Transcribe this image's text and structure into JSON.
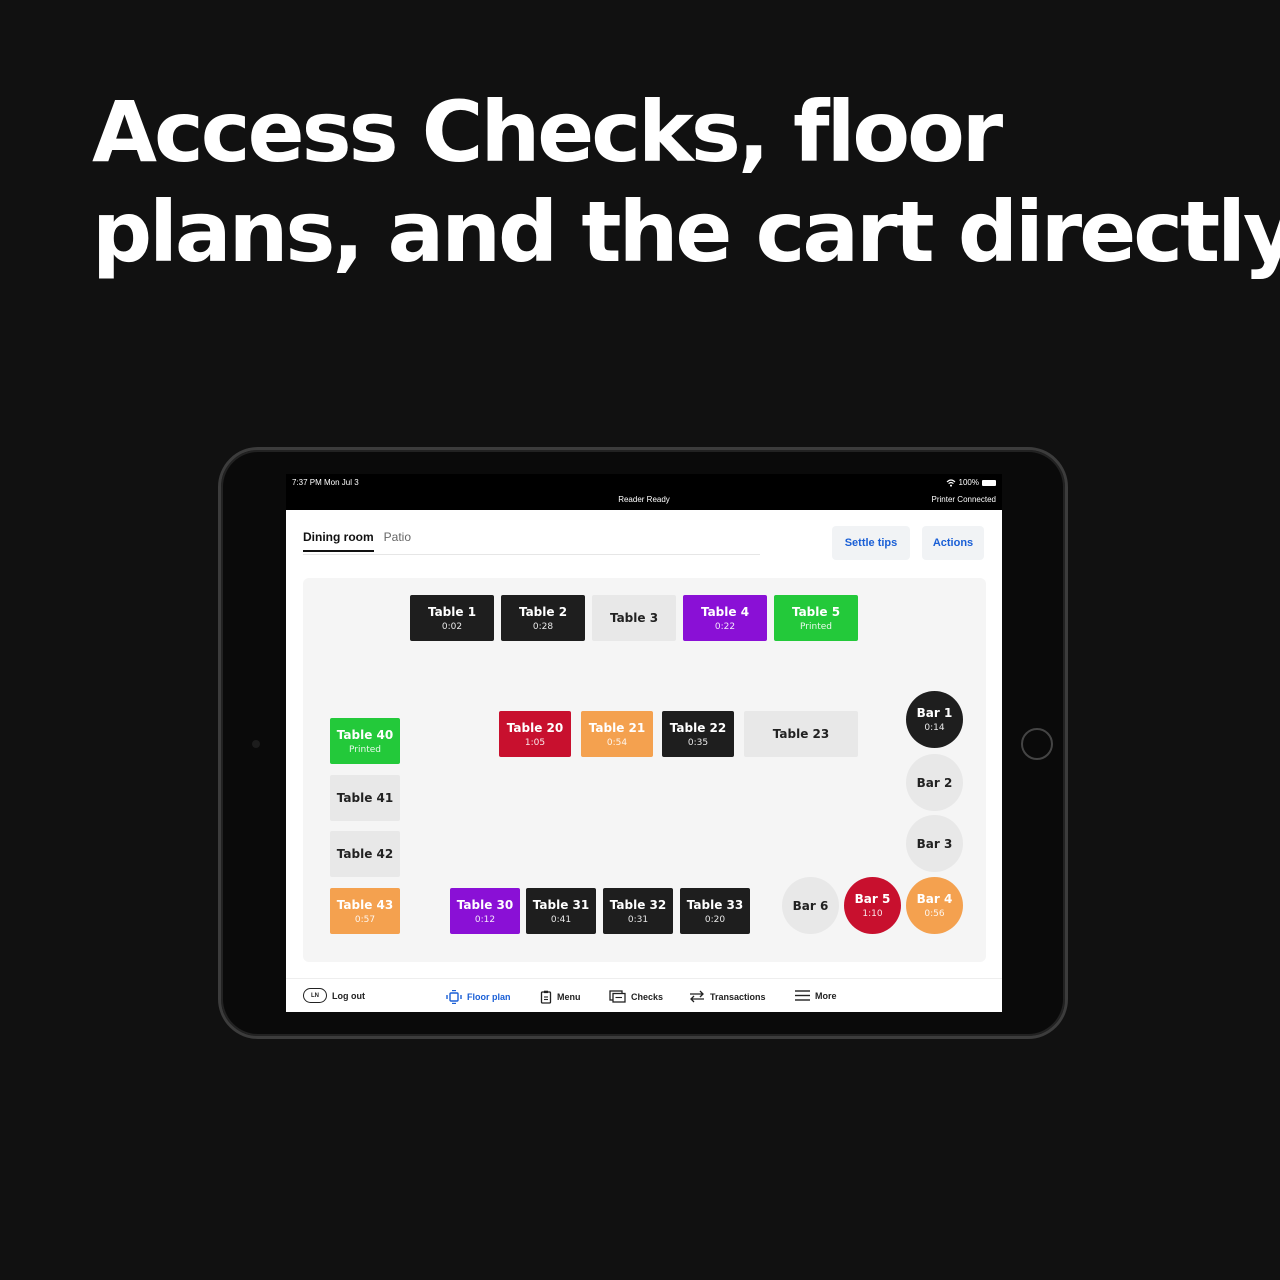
{
  "headline": {
    "line1": "Access Checks, floor",
    "line2": "plans, and the cart directly."
  },
  "statusbar": {
    "time": "7:37 PM  Mon Jul 3",
    "reader": "Reader Ready",
    "battery": "100%",
    "printer": "Printer Connected"
  },
  "tabs": [
    {
      "label": "Dining room"
    },
    {
      "label": "Patio"
    }
  ],
  "buttons": {
    "settle_tips": "Settle tips",
    "actions": "Actions"
  },
  "tables": [
    {
      "label": "Table 1",
      "time": "0:02",
      "color": "#1e1e1e"
    },
    {
      "label": "Table 2",
      "time": "0:28",
      "color": "#1e1e1e"
    },
    {
      "label": "Table 3",
      "time": "",
      "color": "#e8e8e8"
    },
    {
      "label": "Table 4",
      "time": "0:22",
      "color": "#8a10d6"
    },
    {
      "label": "Table 5",
      "time": "Printed",
      "color": "#23c93a"
    },
    {
      "label": "Table 20",
      "time": "1:05",
      "color": "#c8102e"
    },
    {
      "label": "Table 21",
      "time": "0:54",
      "color": "#f4a14f"
    },
    {
      "label": "Table 22",
      "time": "0:35",
      "color": "#1e1e1e"
    },
    {
      "label": "Table 23",
      "time": "",
      "color": "#e8e8e8"
    },
    {
      "label": "Table 40",
      "time": "Printed",
      "color": "#23c93a"
    },
    {
      "label": "Table 41",
      "time": "",
      "color": "#e8e8e8"
    },
    {
      "label": "Table 42",
      "time": "",
      "color": "#e8e8e8"
    },
    {
      "label": "Table 43",
      "time": "0:57",
      "color": "#f4a14f"
    },
    {
      "label": "Table 30",
      "time": "0:12",
      "color": "#8a10d6"
    },
    {
      "label": "Table 31",
      "time": "0:41",
      "color": "#1e1e1e"
    },
    {
      "label": "Table 32",
      "time": "0:31",
      "color": "#1e1e1e"
    },
    {
      "label": "Table 33",
      "time": "0:20",
      "color": "#1e1e1e"
    },
    {
      "label": "Bar 1",
      "time": "0:14",
      "color": "#1e1e1e"
    },
    {
      "label": "Bar 2",
      "time": "",
      "color": "#e8e8e8"
    },
    {
      "label": "Bar 3",
      "time": "",
      "color": "#e8e8e8"
    },
    {
      "label": "Bar 4",
      "time": "0:56",
      "color": "#f4a14f"
    },
    {
      "label": "Bar 5",
      "time": "1:10",
      "color": "#c8102e"
    },
    {
      "label": "Bar 6",
      "time": "",
      "color": "#e8e8e8"
    }
  ],
  "nav": {
    "avatar": "LN",
    "logout": "Log out",
    "floor_plan": "Floor plan",
    "menu": "Menu",
    "checks": "Checks",
    "transactions": "Transactions",
    "more": "More",
    "active_color": "#1a5fd6"
  }
}
